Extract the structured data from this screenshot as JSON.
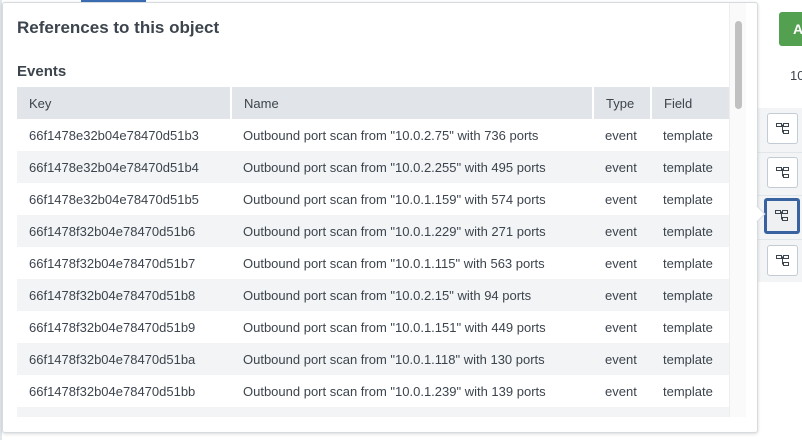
{
  "background": {
    "action_button_label": "A",
    "count_text": "10",
    "tree_buttons": 4,
    "selected_tree_button": 3
  },
  "popup": {
    "title": "References to this object",
    "section": "Events",
    "columns": [
      "Key",
      "Name",
      "Type",
      "Field"
    ],
    "rows": [
      {
        "key": "66f1478e32b04e78470d51b3",
        "name": "Outbound port scan from \"10.0.2.75\" with 736 ports",
        "type": "event",
        "field": "template"
      },
      {
        "key": "66f1478e32b04e78470d51b4",
        "name": "Outbound port scan from \"10.0.2.255\" with 495 ports",
        "type": "event",
        "field": "template"
      },
      {
        "key": "66f1478e32b04e78470d51b5",
        "name": "Outbound port scan from \"10.0.1.159\" with 574 ports",
        "type": "event",
        "field": "template"
      },
      {
        "key": "66f1478f32b04e78470d51b6",
        "name": "Outbound port scan from \"10.0.1.229\" with 271 ports",
        "type": "event",
        "field": "template"
      },
      {
        "key": "66f1478f32b04e78470d51b7",
        "name": "Outbound port scan from \"10.0.1.115\" with 563 ports",
        "type": "event",
        "field": "template"
      },
      {
        "key": "66f1478f32b04e78470d51b8",
        "name": "Outbound port scan from \"10.0.2.15\" with 94 ports",
        "type": "event",
        "field": "template"
      },
      {
        "key": "66f1478f32b04e78470d51b9",
        "name": "Outbound port scan from \"10.0.1.151\" with 449 ports",
        "type": "event",
        "field": "template"
      },
      {
        "key": "66f1478f32b04e78470d51ba",
        "name": "Outbound port scan from \"10.0.1.118\" with 130 ports",
        "type": "event",
        "field": "template"
      },
      {
        "key": "66f1478f32b04e78470d51bb",
        "name": "Outbound port scan from \"10.0.1.239\" with 139 ports",
        "type": "event",
        "field": "template"
      }
    ]
  },
  "colors": {
    "accent": "#3863a0",
    "action_green": "#53a051"
  }
}
